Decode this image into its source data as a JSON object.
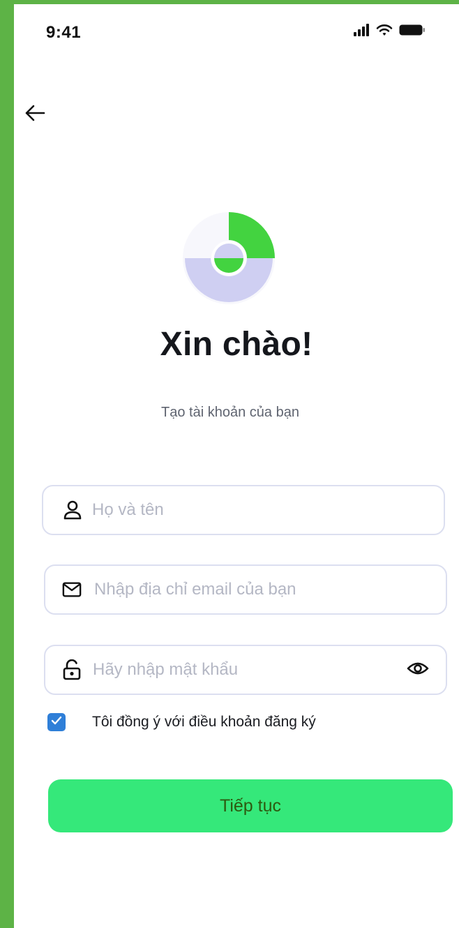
{
  "status_bar": {
    "time": "9:41",
    "signal_icon": "cellular-signal-icon",
    "wifi_icon": "wifi-icon",
    "battery_icon": "battery-icon"
  },
  "navigation": {
    "back_icon": "arrow-left-icon"
  },
  "brand": {
    "logo_icon": "logo-icon",
    "primary_color": "#35e87a",
    "logo_green": "#43d340",
    "logo_lavender": "#cfcff2"
  },
  "header": {
    "title": "Xin chào!",
    "subtitle": "Tạo tài khoản của bạn"
  },
  "form": {
    "name": {
      "icon": "user-icon",
      "value": "",
      "placeholder": "Họ và tên"
    },
    "email": {
      "icon": "mail-icon",
      "value": "",
      "placeholder": "Nhập địa chỉ email của bạn"
    },
    "password": {
      "icon": "lock-icon",
      "value": "",
      "placeholder": "Hãy nhập mật khẩu",
      "toggle_icon": "eye-icon"
    },
    "agree": {
      "checked": true,
      "label": "Tôi đồng ý với điều khoản đăng ký"
    },
    "submit_label": "Tiếp tục"
  }
}
